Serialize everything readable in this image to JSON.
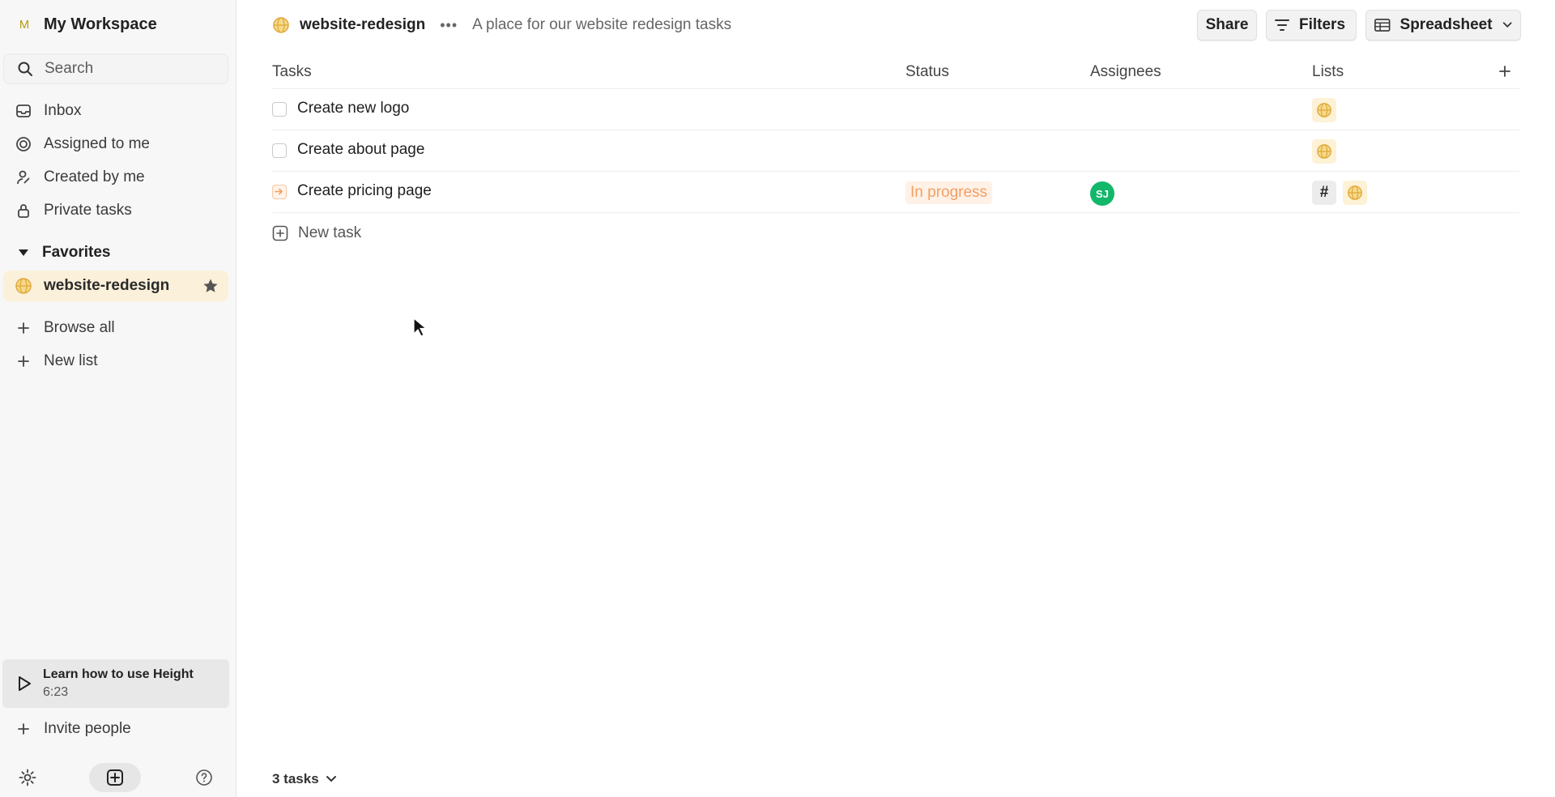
{
  "sidebar": {
    "workspace": {
      "badge": "M",
      "title": "My Workspace"
    },
    "search": {
      "placeholder": "Search"
    },
    "nav": [
      {
        "label": "Inbox",
        "icon": "inbox-icon"
      },
      {
        "label": "Assigned to me",
        "icon": "target-icon"
      },
      {
        "label": "Created by me",
        "icon": "user-icon"
      },
      {
        "label": "Private tasks",
        "icon": "lock-icon"
      }
    ],
    "favorites": {
      "label": "Favorites",
      "items": [
        {
          "label": "website-redesign",
          "icon": "globe-icon"
        }
      ]
    },
    "browse_all": "Browse all",
    "new_list": "New list",
    "learn": {
      "title": "Learn how to use Height",
      "duration": "6:23"
    },
    "invite": "Invite people"
  },
  "header": {
    "list_title": "website-redesign",
    "description": "A place for our website redesign tasks",
    "share_label": "Share",
    "filters_label": "Filters",
    "view_label": "Spreadsheet"
  },
  "table": {
    "columns": [
      "Tasks",
      "Status",
      "Assignees",
      "Lists"
    ],
    "rows": [
      {
        "name": "Create new logo",
        "status": "",
        "assignee": "",
        "lists": [
          "globe"
        ]
      },
      {
        "name": "Create about page",
        "status": "",
        "assignee": "",
        "lists": [
          "globe"
        ]
      },
      {
        "name": "Create pricing page",
        "status": "In progress",
        "assignee": "SJ",
        "lists": [
          "#",
          "globe"
        ]
      }
    ],
    "new_task_label": "New task"
  },
  "footer": {
    "count_label": "3 tasks"
  },
  "colors": {
    "accent_yellow": "#e8b53a",
    "favorite_bg": "#fbf0da",
    "status_in_progress": "#f0a066",
    "avatar_green": "#12b76a"
  }
}
